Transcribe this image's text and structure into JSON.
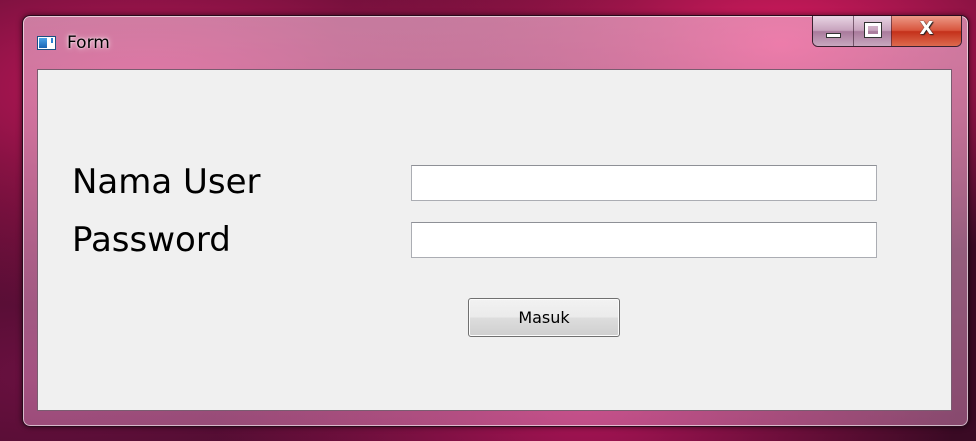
{
  "window": {
    "title": "Form"
  },
  "title_bar_buttons": {
    "minimize_icon": "minimize-icon",
    "maximize_icon": "maximize-icon",
    "close_icon": "close-icon",
    "close_glyph": "X"
  },
  "form": {
    "username_label": "Nama User",
    "username_value": "",
    "password_label": "Password",
    "password_value": "",
    "submit_label": "Masuk"
  },
  "colors": {
    "client_background": "#f0f0f0",
    "close_button": "#c4301a",
    "desktop_accent": "#c2185b"
  }
}
